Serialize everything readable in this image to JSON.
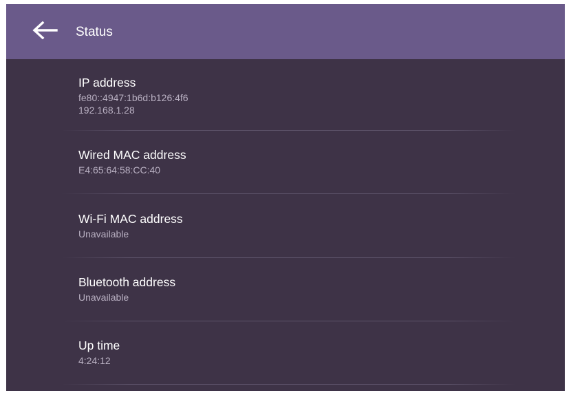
{
  "header": {
    "title": "Status",
    "back_icon": "arrow-left-icon"
  },
  "items": [
    {
      "title": "IP address",
      "values": [
        "fe80::4947:1b6d:b126:4f6",
        "192.168.1.28"
      ]
    },
    {
      "title": "Wired MAC address",
      "values": [
        "E4:65:64:58:CC:40"
      ]
    },
    {
      "title": "Wi-Fi MAC address",
      "values": [
        "Unavailable"
      ]
    },
    {
      "title": "Bluetooth address",
      "values": [
        "Unavailable"
      ]
    },
    {
      "title": "Up time",
      "values": [
        "4:24:12"
      ]
    }
  ],
  "colors": {
    "appbar": "#6a5a8a",
    "background": "#3e3347",
    "title_text": "#ffffff",
    "value_text": "#b9b0c2"
  }
}
